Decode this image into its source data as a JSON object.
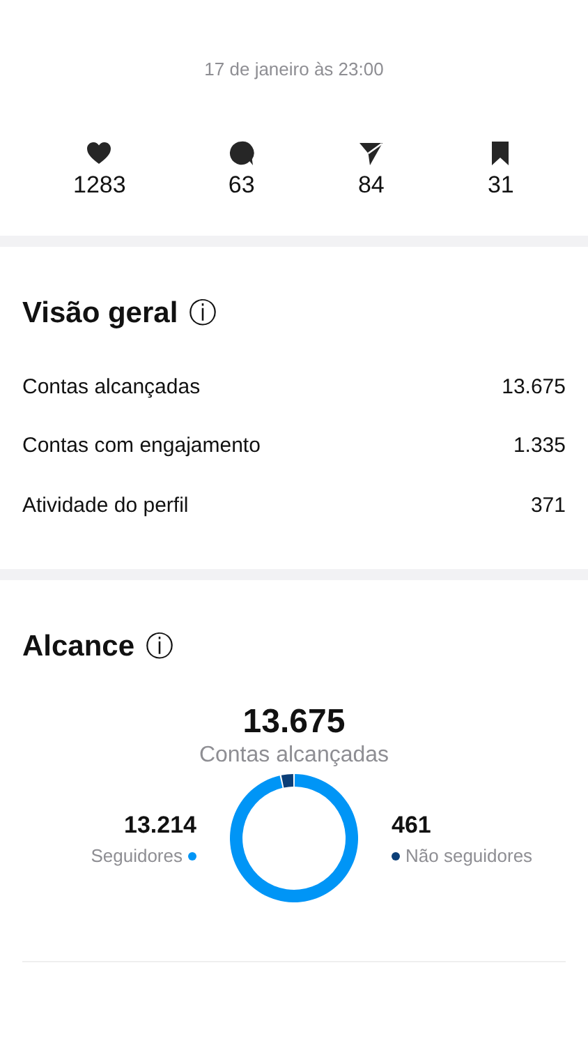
{
  "post": {
    "date": "17 de janeiro às 23:00",
    "stats": [
      {
        "kind": "likes",
        "value": "1283"
      },
      {
        "kind": "comments",
        "value": "63"
      },
      {
        "kind": "shares",
        "value": "84"
      },
      {
        "kind": "saves",
        "value": "31"
      }
    ]
  },
  "overview": {
    "title": "Visão geral",
    "info": "ⓘ",
    "rows": [
      {
        "label": "Contas alcançadas",
        "value": "13.675"
      },
      {
        "label": "Contas com engajamento",
        "value": "1.335"
      },
      {
        "label": "Atividade do perfil",
        "value": "371"
      }
    ]
  },
  "reach": {
    "info": "ⓘ",
    "total": "13.675",
    "total_label": "Contas alcançadas",
    "legend": [
      {
        "value": "13.214",
        "color": "#0095f6"
      },
      {
        "value": "461",
        "color": "#0b3e77"
      }
    ],
    "chart_data": {
      "type": "donut",
      "title": "Alcance",
      "categories": [
        "Seguidores",
        "Não seguidores"
      ],
      "series": [
        {
          "values": [
            96.63,
            3.37
          ]
        }
      ]
    }
  }
}
